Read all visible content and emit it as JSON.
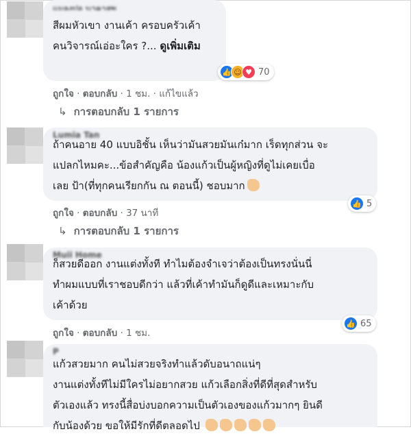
{
  "comments": [
    {
      "author": "แมลงปอ นาคาสุข",
      "lines": [
        "สีผมหัวเขา งานเค้า ครอบครัวเค้า",
        "คนวิจารณ์เอ่อะใคร ?..."
      ],
      "see_more": "ดูเพิ่มเติม",
      "reaction_count": "70",
      "like_label": "ถูกใจ",
      "reply_label": "ตอบกลับ",
      "time": "1 ชม.",
      "edited": "แก้ไขแล้ว",
      "replies_label": "การตอบกลับ 1 รายการ"
    },
    {
      "author": "Lumia Tan",
      "lines": [
        "ถ้าคนอาย 40 แบบอิชั้น เห็นว่ามันสวยมันเก๋มาก เร็ดทุกส่วน จะ",
        "แปลกไหมคะ...ข้อสำคัญคือ น้องแก้วเป็นผู้หญิงที่ดูไม่เคยเบื่อ",
        "เลย ป้า(ที่ทุกคนเรียกกัน ณ ตอนนี้) ชอบมาก"
      ],
      "reaction_count": "5",
      "like_label": "ถูกใจ",
      "reply_label": "ตอบกลับ",
      "time": "37 นาที",
      "replies_label": "การตอบกลับ 1 รายการ"
    },
    {
      "author": "Muji Home",
      "lines": [
        "ก็สวยดีออก งานแต่งทั้งที ทำไมต้องจำเจว่าต้องเป็นทรงนั่นนี่",
        "ทำผมแบบที่เราชอบดีกว่า แล้วที่เค้าทำมันก็ดูดีและเหมาะกับ",
        "เค้าด้วย"
      ],
      "reaction_count": "65",
      "like_label": "ถูกใจ",
      "reply_label": "ตอบกลับ",
      "time": "1 ชม."
    },
    {
      "author": "P",
      "lines": [
        "แก้วสวยมาก คนไม่สวยจริงทำแล้วดับอนาถแน่ๆ",
        "งานแต่งทั้งทีไม่มีใครไม่อยากสวย แก้วเลือกสิ่งที่ดีที่สุดสำหรับ",
        "ตัวเองแล้ว ทรงนี้สื่อบ่งบอกความเป็นตัวเองของแก้วมากๆ ยินดี",
        "กับน้องด้วย ขอให้มีรักที่ดีตลอดไป"
      ]
    }
  ],
  "icons": {
    "like": "thumbs-up-icon",
    "haha": "haha-face-icon",
    "love": "heart-icon",
    "reply_arrow": "reply-arrow-icon"
  },
  "colors": {
    "like": "#1877f2",
    "love": "#f33e58",
    "haha": "#f7b125",
    "bubble": "#f0f2f5",
    "meta": "#65676b"
  }
}
